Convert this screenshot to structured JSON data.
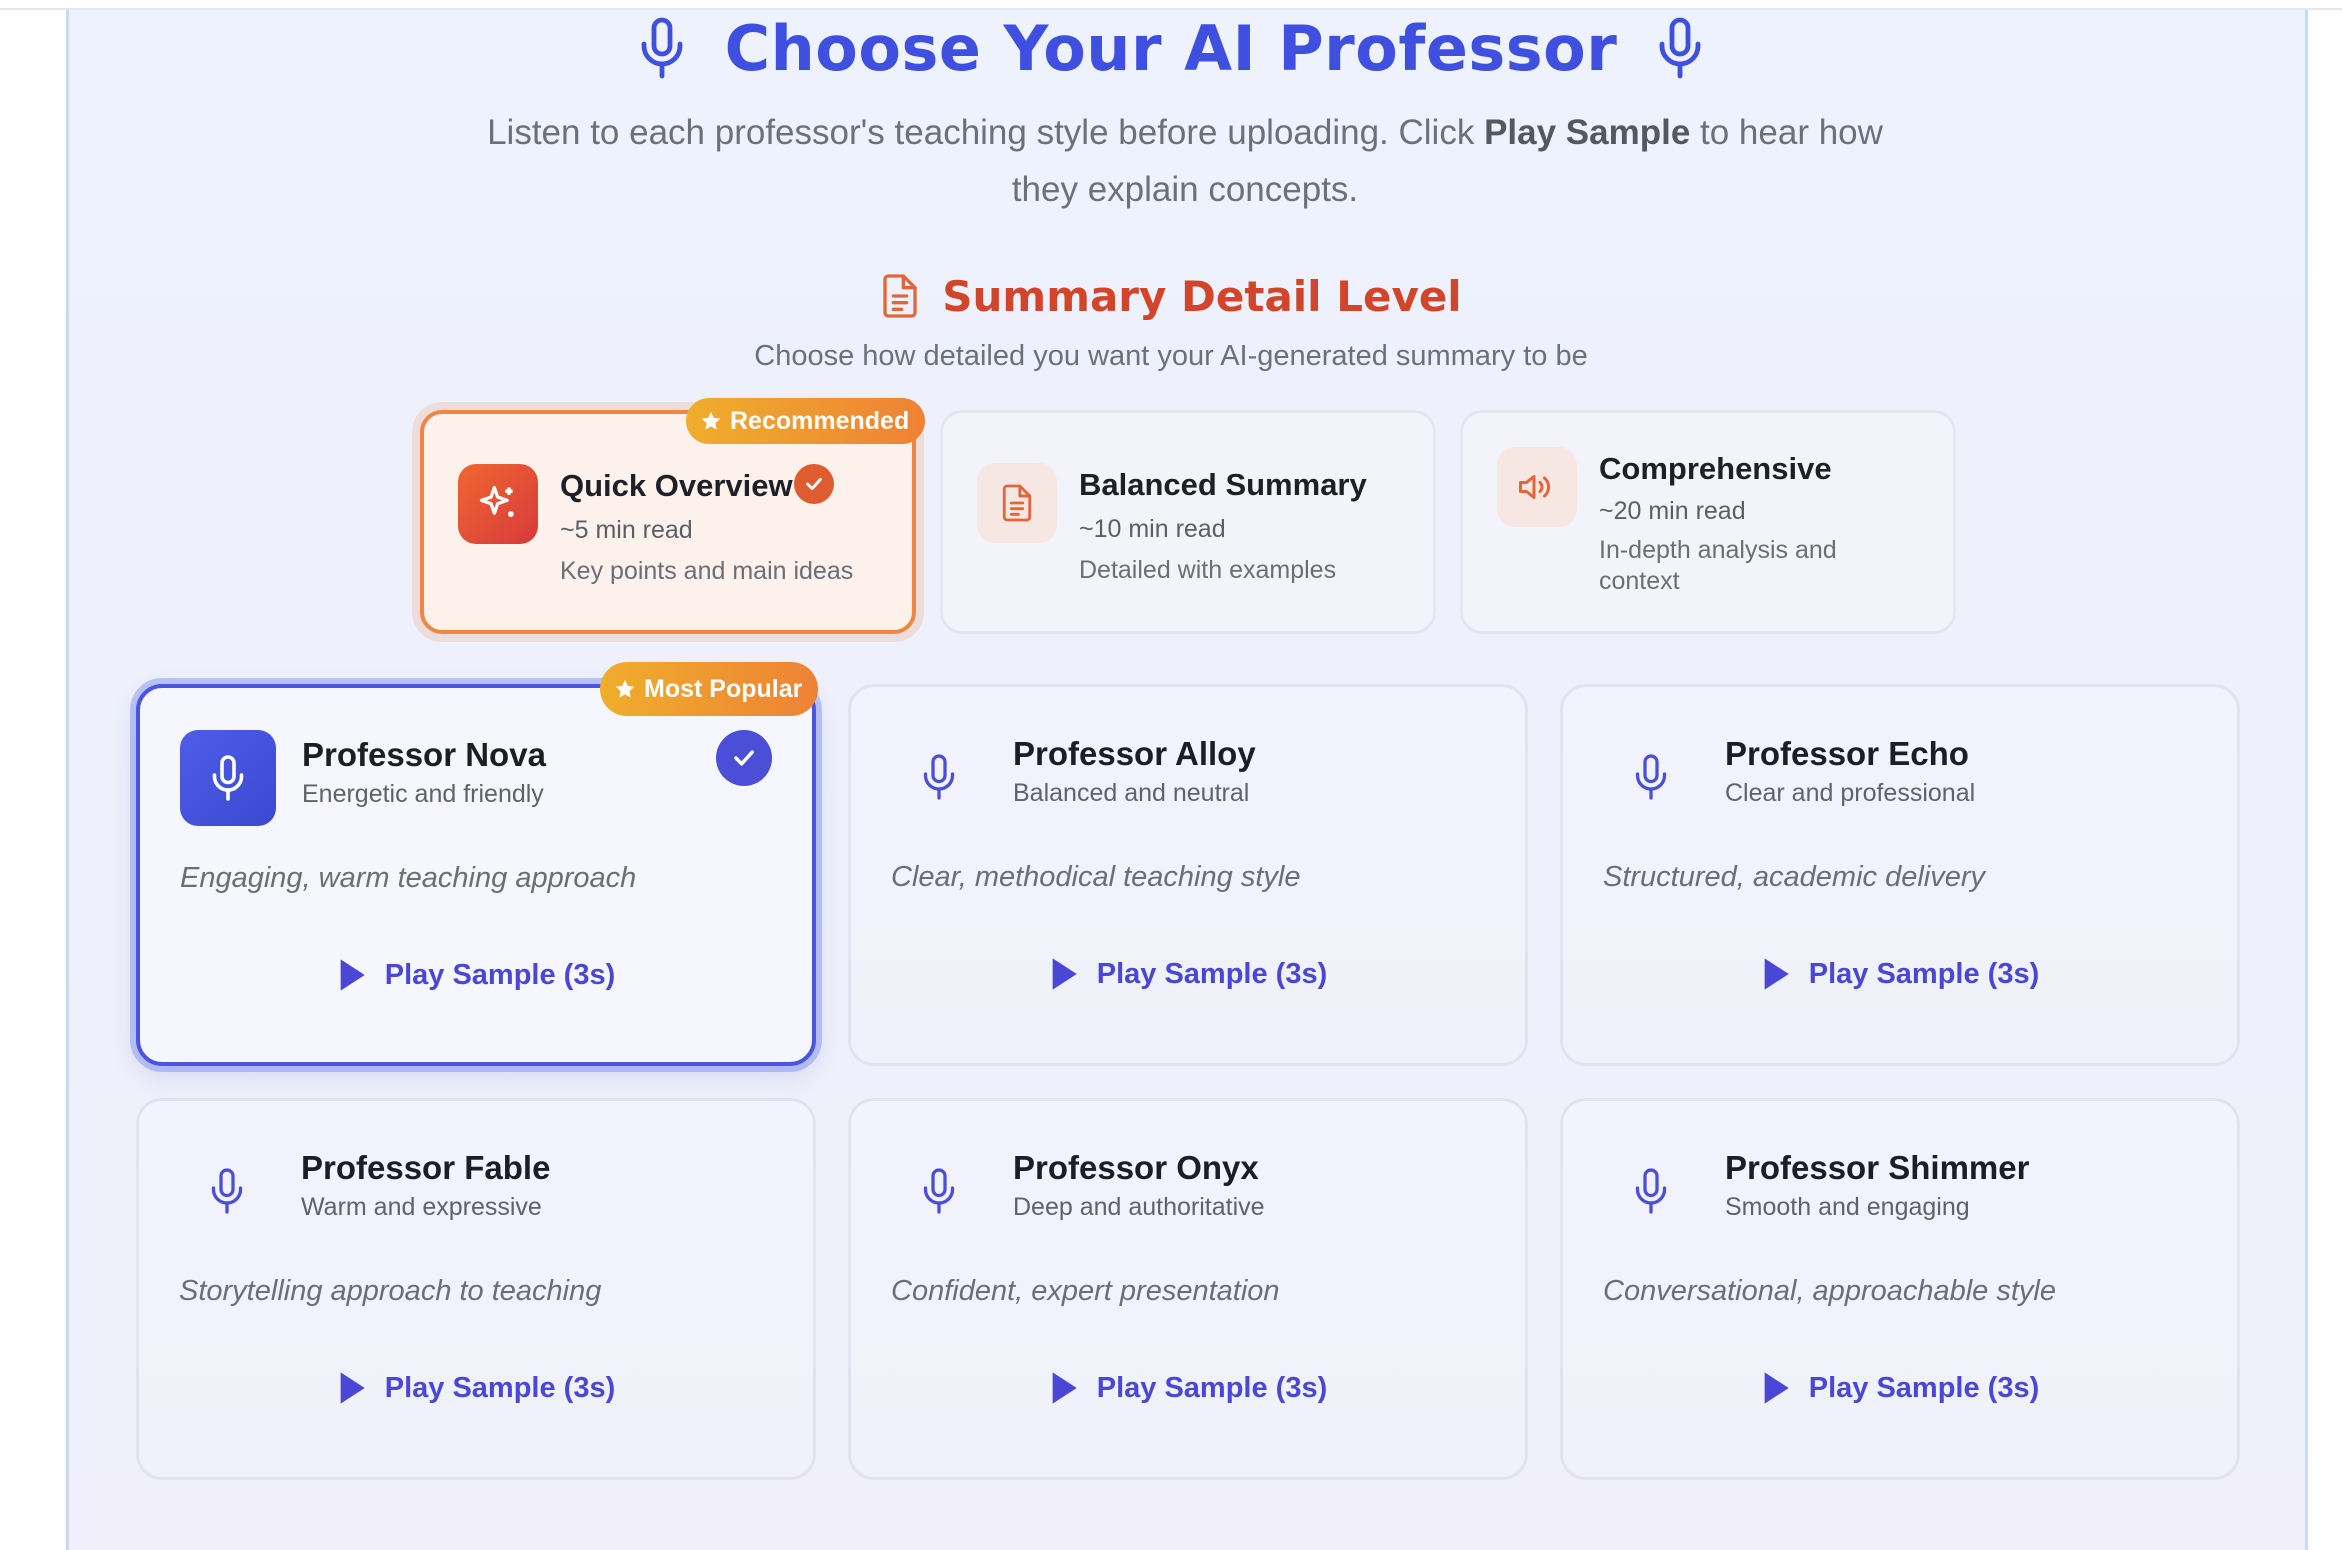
{
  "header": {
    "title": "Choose Your AI Professor",
    "subtitle_pre": "Listen to each professor's teaching style before uploading. Click ",
    "subtitle_bold": "Play Sample",
    "subtitle_post": " to hear how they explain concepts.",
    "icons": [
      "microphone-icon",
      "microphone-icon"
    ]
  },
  "summary": {
    "title": "Summary Detail Level",
    "icon": "document-icon",
    "subtitle": "Choose how detailed you want your AI-generated summary to be",
    "options": [
      {
        "name": "Quick Overview",
        "time": "~5 min read",
        "desc": "Key points and main ideas",
        "icon": "sparkles-icon",
        "selected": true,
        "badge": "Recommended"
      },
      {
        "name": "Balanced Summary",
        "time": "~10 min read",
        "desc": "Detailed with examples",
        "icon": "document-icon",
        "selected": false
      },
      {
        "name": "Comprehensive",
        "time": "~20 min read",
        "desc": "In-depth analysis and context",
        "icon": "speaker-icon",
        "selected": false
      }
    ]
  },
  "professors": [
    {
      "name": "Professor Nova",
      "tag": "Energetic and friendly",
      "desc": "Engaging, warm teaching approach",
      "play": "Play Sample (3s)",
      "selected": true,
      "badge": "Most Popular"
    },
    {
      "name": "Professor Alloy",
      "tag": "Balanced and neutral",
      "desc": "Clear, methodical teaching style",
      "play": "Play Sample (3s)",
      "selected": false
    },
    {
      "name": "Professor Echo",
      "tag": "Clear and professional",
      "desc": "Structured, academic delivery",
      "play": "Play Sample (3s)",
      "selected": false
    },
    {
      "name": "Professor Fable",
      "tag": "Warm and expressive",
      "desc": "Storytelling approach to teaching",
      "play": "Play Sample (3s)",
      "selected": false
    },
    {
      "name": "Professor Onyx",
      "tag": "Deep and authoritative",
      "desc": "Confident, expert presentation",
      "play": "Play Sample (3s)",
      "selected": false
    },
    {
      "name": "Professor Shimmer",
      "tag": "Smooth and engaging",
      "desc": "Conversational, approachable style",
      "play": "Play Sample (3s)",
      "selected": false
    }
  ],
  "colors": {
    "primary": "#3f4fe0",
    "accent_orange": "#d2452a",
    "badge_gradient": [
      "#efae2c",
      "#ee8235"
    ]
  }
}
